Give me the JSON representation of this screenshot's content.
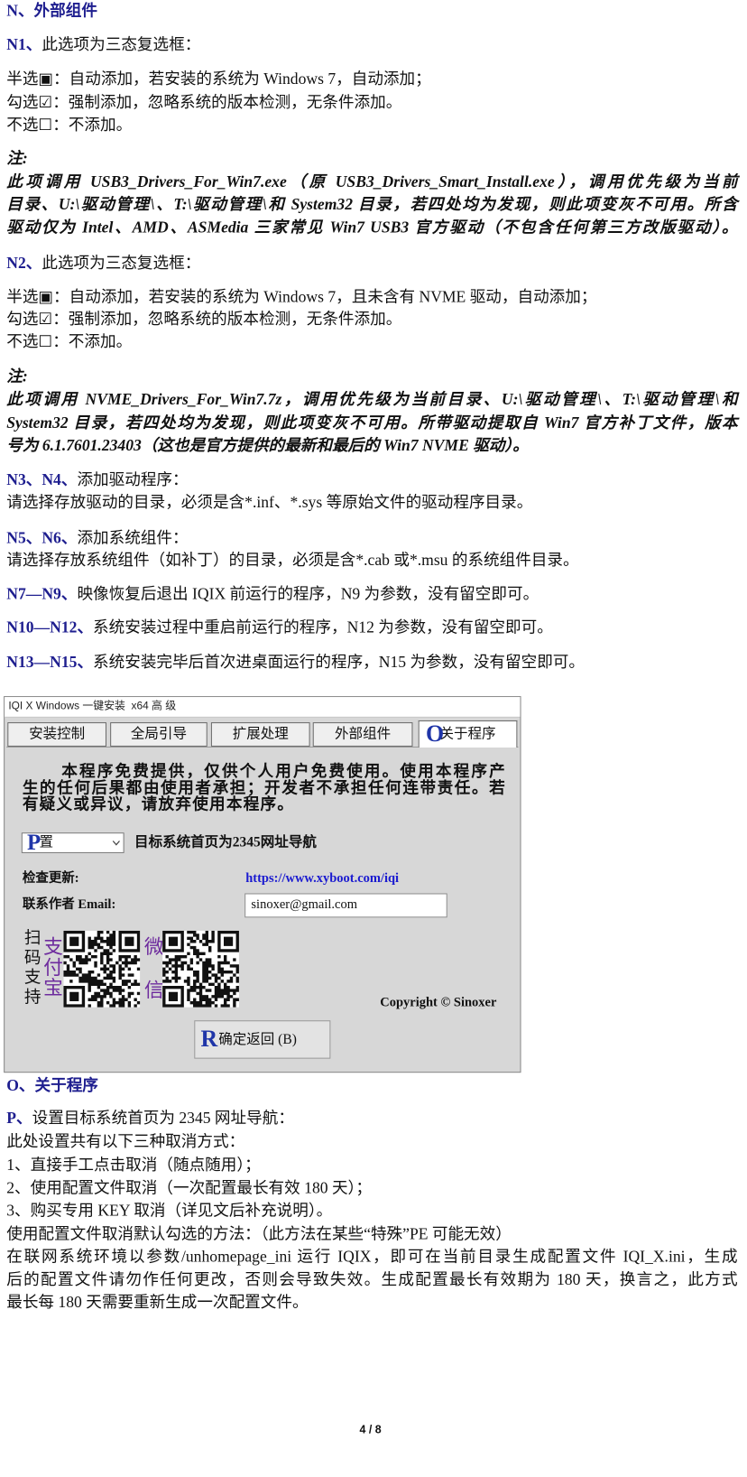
{
  "colors": {
    "heading_blue": "#1e1e8f",
    "marker_blue": "#1f35a8",
    "link_blue": "#1a1ad0",
    "support_purple": "#6e2c9e",
    "window_bg": "#d7d7d7"
  },
  "doc": {
    "n_heading": "N、外部组件",
    "n1": {
      "label": "N1、",
      "text": "此选项为三态复选框："
    },
    "n1_options": [
      "半选▣：自动添加，若安装的系统为 Windows 7，自动添加；",
      "勾选☑：强制添加，忽略系统的版本检测，无条件添加。",
      "不选☐：不添加。"
    ],
    "n1_note_title": "注:",
    "n1_note_lines": [
      "此项调用 USB3_Drivers_For_Win7.exe（原 USB3_Drivers_Smart_Install.exe），调用优先级为当前",
      "目录、U:\\驱动管理\\、T:\\驱动管理\\和 System32 目录，若四处均为发现，则此项变灰不可用。所含",
      "驱动仅为 Intel、AMD、ASMedia 三家常见 Win7 USB3 官方驱动（不包含任何第三方改版驱动）。"
    ],
    "n2": {
      "label": "N2、",
      "text": "此选项为三态复选框："
    },
    "n2_options": [
      "半选▣：自动添加，若安装的系统为 Windows 7，且未含有 NVME 驱动，自动添加；",
      "勾选☑：强制添加，忽略系统的版本检测，无条件添加。",
      "不选☐：不添加。"
    ],
    "n2_note_title": "注:",
    "n2_note_lines": [
      "此项调用 NVME_Drivers_For_Win7.7z，调用优先级为当前目录、U:\\驱动管理\\、T:\\驱动管理\\和",
      "System32 目录，若四处均为发现，则此项变灰不可用。所带驱动提取自 Win7 官方补丁文件，版本",
      "号为 6.1.7601.23403（这也是官方提供的最新和最后的 Win7 NVME 驱动）。"
    ],
    "n3": {
      "label": "N3、N4、",
      "text": "添加驱动程序：",
      "desc": "请选择存放驱动的目录，必须是含*.inf、*.sys 等原始文件的驱动程序目录。"
    },
    "n5": {
      "label": "N5、N6、",
      "text": "添加系统组件：",
      "desc": "请选择存放系统组件（如补丁）的目录，必须是含*.cab 或*.msu 的系统组件目录。"
    },
    "n7": {
      "label": "N7—N9、",
      "text": "映像恢复后退出 IQIX 前运行的程序，N9 为参数，没有留空即可。"
    },
    "n10": {
      "label": "N10—N12、",
      "text": "系统安装过程中重启前运行的程序，N12 为参数，没有留空即可。"
    },
    "n13": {
      "label": "N13—N15、",
      "text": "系统安装完毕后首次进桌面运行的程序，N15 为参数，没有留空即可。"
    },
    "o_heading": "O、关于程序",
    "p": {
      "label": "P、",
      "text": "设置目标系统首页为 2345 网址导航："
    },
    "p_lines": [
      "此处设置共有以下三种取消方式：",
      "1、直接手工点击取消（随点随用）；",
      "2、使用配置文件取消（一次配置最长有效 180 天）；",
      "3、购买专用 KEY 取消（详见文后补充说明）。",
      "使用配置文件取消默认勾选的方法：（此方法在某些“特殊”PE 可能无效）",
      "在联网系统环境以参数/unhomepage_ini 运行 IQIX，即可在当前目录生成配置文件 IQI_X.ini，生成",
      "后的配置文件请勿作任何更改，否则会导致失效。生成配置最长有效期为 180 天，换言之，此方式",
      "最长每 180 天需要重新生成一次配置文件。"
    ],
    "footer_page": "4 / 8"
  },
  "window": {
    "title": "IQI X Windows 一键安装  x64 高 级",
    "tabs": [
      "安装控制",
      "全局引导",
      "扩展处理",
      "外部组件",
      "关于程序"
    ],
    "disclaimer_lines": [
      "本程序免费提供，仅供个人用户免费使用。使用本程序产",
      "生的任何后果都由使用者承担；开发者不承担任何连带责任。若",
      "有疑义或异议，请放弃使用本程序。"
    ],
    "homepage_select": {
      "value": "置",
      "label": "目标系统首页为2345网址导航"
    },
    "update": {
      "label": "检查更新:",
      "link": "https://www.xyboot.com/iqi"
    },
    "contact": {
      "label": "联系作者 Email:",
      "value": "sinoxer@gmail.com"
    },
    "support": {
      "label": "扫码支持",
      "alipay": "支付宝",
      "wechat": "微信"
    },
    "copyright": "Copyright © Sinoxer",
    "ok_button": "确定返回 (B)",
    "annotations": {
      "tab_marker": "O",
      "select_marker": "P",
      "button_marker": "R"
    }
  }
}
